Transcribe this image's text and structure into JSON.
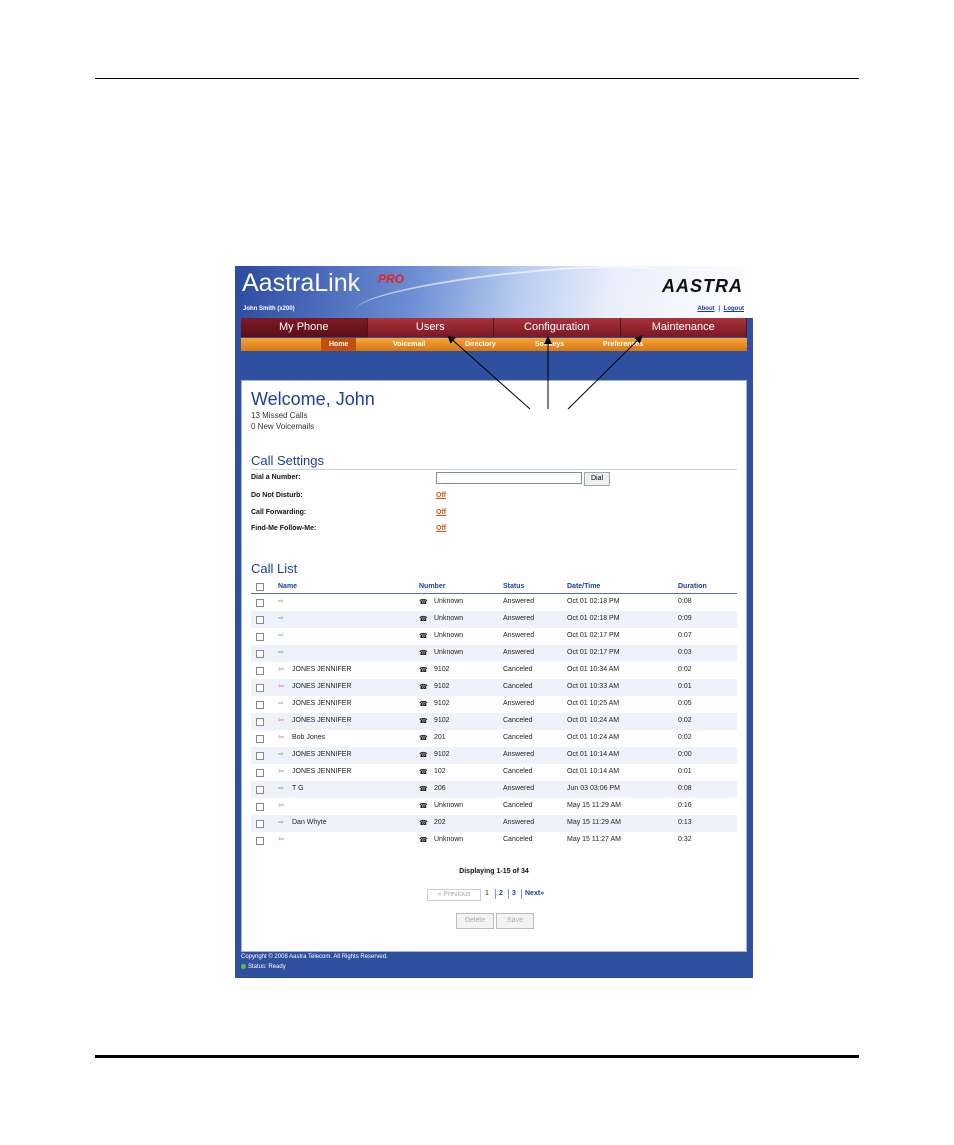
{
  "app": {
    "logo": "AastraLink",
    "logo_suffix": "PRO",
    "brand": "AASTRA"
  },
  "header": {
    "user": "John Smith (x200)",
    "about": "About",
    "separator": "|",
    "logout": "Logout"
  },
  "main_nav": [
    "My Phone",
    "Users",
    "Configuration",
    "Maintenance"
  ],
  "sub_nav": [
    "Home",
    "Voicemail",
    "Directory",
    "Softkeys",
    "Preferences"
  ],
  "welcome": {
    "title": "Welcome, John",
    "missed": "13 Missed Calls",
    "voicemails": "0 New Voicemails"
  },
  "call_settings": {
    "title": "Call Settings",
    "dial_label": "Dial a Number:",
    "dial_value": "",
    "dial_button": "Dial",
    "dnd_label": "Do Not Disturb:",
    "dnd_value": "Off",
    "fwd_label": "Call Forwarding:",
    "fwd_value": "Off",
    "fmfm_label": "Find-Me Follow-Me:",
    "fmfm_value": "Off"
  },
  "call_list": {
    "title": "Call List",
    "columns": [
      "Name",
      "Number",
      "Status",
      "Date/Time",
      "Duration"
    ],
    "rows": [
      {
        "dir": "in",
        "name": "",
        "number": "Unknown",
        "status": "Answered",
        "datetime": "Oct 01 02:18 PM",
        "duration": "0:08"
      },
      {
        "dir": "in",
        "name": "",
        "number": "Unknown",
        "status": "Answered",
        "datetime": "Oct 01 02:18 PM",
        "duration": "0:09"
      },
      {
        "dir": "in",
        "name": "",
        "number": "Unknown",
        "status": "Answered",
        "datetime": "Oct 01 02:17 PM",
        "duration": "0:07"
      },
      {
        "dir": "in",
        "name": "",
        "number": "Unknown",
        "status": "Answered",
        "datetime": "Oct 01 02:17 PM",
        "duration": "0:03"
      },
      {
        "dir": "out",
        "name": "JONES JENNIFER",
        "number": "9102",
        "status": "Canceled",
        "datetime": "Oct 01 10:34 AM",
        "duration": "0:02"
      },
      {
        "dir": "out",
        "name": "JONES JENNIFER",
        "number": "9102",
        "status": "Canceled",
        "datetime": "Oct 01 10:33 AM",
        "duration": "0:01"
      },
      {
        "dir": "in",
        "name": "JONES JENNIFER",
        "number": "9102",
        "status": "Answered",
        "datetime": "Oct 01 10:25 AM",
        "duration": "0:05"
      },
      {
        "dir": "out",
        "name": "JONES JENNIFER",
        "number": "9102",
        "status": "Canceled",
        "datetime": "Oct 01 10:24 AM",
        "duration": "0:02"
      },
      {
        "dir": "out",
        "name": "Bob Jones",
        "number": "201",
        "status": "Canceled",
        "datetime": "Oct 01 10:24 AM",
        "duration": "0:02"
      },
      {
        "dir": "in",
        "name": "JONES JENNIFER",
        "number": "9102",
        "status": "Answered",
        "datetime": "Oct 01 10:14 AM",
        "duration": "0:00"
      },
      {
        "dir": "out",
        "name": "JONES JENNIFER",
        "number": "102",
        "status": "Canceled",
        "datetime": "Oct 01 10:14 AM",
        "duration": "0:01"
      },
      {
        "dir": "in",
        "name": "T G",
        "number": "206",
        "status": "Answered",
        "datetime": "Jun 03 03:06 PM",
        "duration": "0:08"
      },
      {
        "dir": "out",
        "name": "",
        "number": "Unknown",
        "status": "Canceled",
        "datetime": "May 15 11:29 AM",
        "duration": "0:16"
      },
      {
        "dir": "in",
        "name": "Dan Whyte",
        "number": "202",
        "status": "Answered",
        "datetime": "May 15 11:29 AM",
        "duration": "0:13"
      },
      {
        "dir": "out",
        "name": "",
        "number": "Unknown",
        "status": "Canceled",
        "datetime": "May 15 11:27 AM",
        "duration": "0:32"
      }
    ],
    "displaying": "Displaying 1-15 of 34",
    "pager": {
      "prev": "« Previous",
      "pages": [
        "1",
        "2",
        "3"
      ],
      "next": "Next»"
    },
    "delete_button": "Delete",
    "save_button": "Save"
  },
  "footer": {
    "copyright": "Copyright © 2008 Aastra Telecom. All Rights Reserved.",
    "status": "Status: Ready"
  },
  "colors": {
    "nav_red": "#8e2430",
    "sub_orange": "#e88a22",
    "title_blue": "#1f3e9a",
    "frame_blue": "#2f4f9f"
  }
}
